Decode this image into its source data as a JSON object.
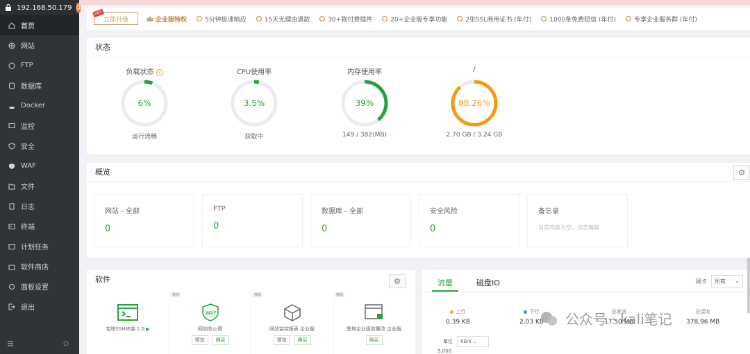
{
  "sidebar": {
    "ip": "192.168.50.179",
    "badge": "0",
    "items": [
      {
        "label": "首页",
        "icon": "home-icon",
        "active": true
      },
      {
        "label": "网站",
        "icon": "globe-icon"
      },
      {
        "label": "FTP",
        "icon": "ftp-icon"
      },
      {
        "label": "数据库",
        "icon": "database-icon"
      },
      {
        "label": "Docker",
        "icon": "docker-icon"
      },
      {
        "label": "监控",
        "icon": "monitor-icon"
      },
      {
        "label": "安全",
        "icon": "shield-icon"
      },
      {
        "label": "WAF",
        "icon": "waf-icon"
      },
      {
        "label": "文件",
        "icon": "folder-icon"
      },
      {
        "label": "日志",
        "icon": "log-icon"
      },
      {
        "label": "终端",
        "icon": "terminal-icon"
      },
      {
        "label": "计划任务",
        "icon": "task-icon"
      },
      {
        "label": "软件商店",
        "icon": "store-icon"
      },
      {
        "label": "面板设置",
        "icon": "settings-icon"
      },
      {
        "label": "退出",
        "icon": "logout-icon"
      }
    ]
  },
  "promo": {
    "upgrade": "立即升级",
    "enterprise": "企业版特权",
    "features": [
      "5分钟极速响应",
      "15天无理由退款",
      "30+款付费插件",
      "20+企业版专享功能",
      "2张SSL商用证书 (年付)",
      "1000条免费短信 (年付)",
      "专享企业服务群 (年付)"
    ]
  },
  "status": {
    "title": "状态",
    "gauges": [
      {
        "label": "负载状态",
        "value": "6%",
        "percent": 6,
        "sub": "运行流畅",
        "color": "#20a53a"
      },
      {
        "label": "CPU使用率",
        "value": "3.5%",
        "percent": 3.5,
        "sub": "获取中",
        "color": "#20a53a"
      },
      {
        "label": "内存使用率",
        "value": "39%",
        "percent": 39,
        "sub": "149 / 382(MB)",
        "color": "#20a53a"
      },
      {
        "label": "/",
        "value": "88.26%",
        "percent": 88.26,
        "sub": "2.70 GB / 3.24 GB",
        "color": "#f39c12"
      }
    ]
  },
  "overview": {
    "title": "概览",
    "cards": [
      {
        "title": "网站 - 全部",
        "value": "0"
      },
      {
        "title": "FTP",
        "value": "0"
      },
      {
        "title": "数据库 - 全部",
        "value": "0"
      },
      {
        "title": "安全风险",
        "value": "0"
      }
    ],
    "memo_title": "备忘录",
    "memo_text": "当前内容为空，点击编辑"
  },
  "software": {
    "title": "软件",
    "items": [
      {
        "name": "宝塔SSH终端 1.0",
        "tag": "",
        "preview": "",
        "buy": ""
      },
      {
        "name": "网站防火墙",
        "tag": "推荐",
        "preview": "预览",
        "buy": "购买"
      },
      {
        "name": "网站监控报表 企业版",
        "tag": "推荐",
        "preview": "预览",
        "buy": "购买"
      },
      {
        "name": "堡塔企业级防篡改 企业版",
        "tag": "推荐",
        "preview": "",
        "buy": "购买"
      }
    ]
  },
  "traffic": {
    "tabs": [
      "流量",
      "磁盘IO"
    ],
    "iface_label": "网卡",
    "iface_value": "所有",
    "stats": [
      {
        "label": "上行",
        "value": "0.39 KB",
        "color": "#f5a623"
      },
      {
        "label": "下行",
        "value": "2.03 KB",
        "color": "#4a90e2"
      },
      {
        "label": "总发送",
        "value": "17.50 MB",
        "color": ""
      },
      {
        "label": "总接收",
        "value": "378.96 MB",
        "color": ""
      }
    ],
    "unit_label": "单位",
    "unit_value": "KB/s",
    "y_top": "5,000"
  },
  "watermark": "公众号 · kali笔记"
}
